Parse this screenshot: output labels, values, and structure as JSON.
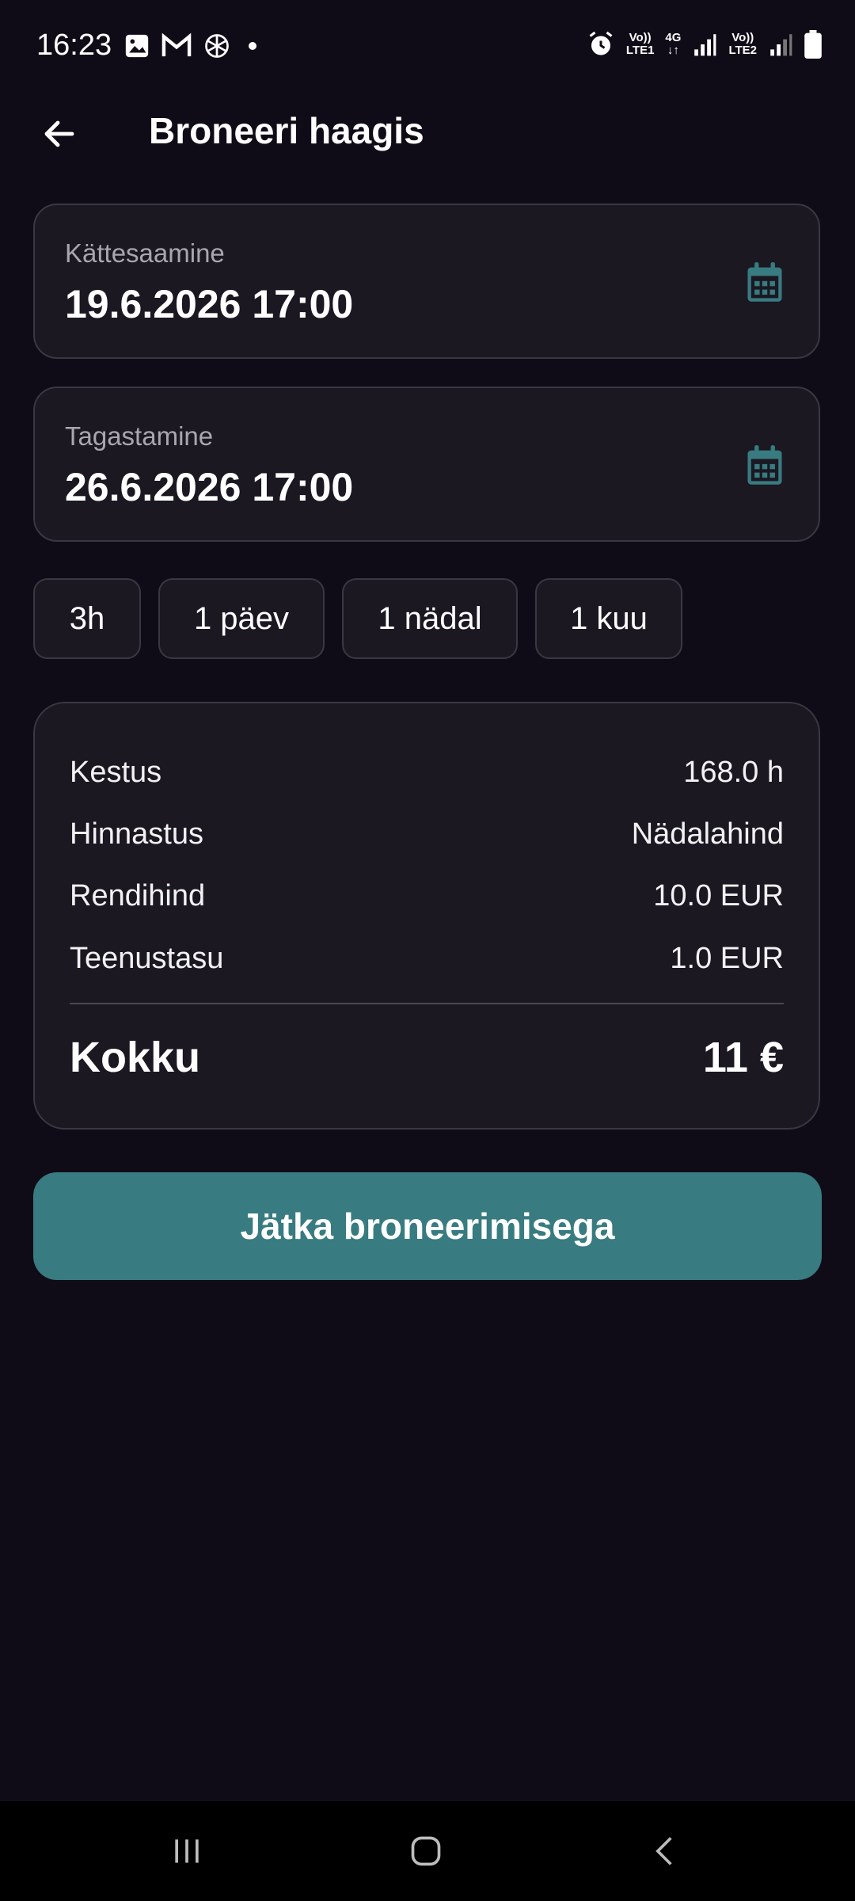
{
  "status_bar": {
    "time": "16:23",
    "left_icons": [
      "gallery-icon",
      "gmail-icon",
      "chatgpt-icon",
      "dot-icon"
    ],
    "net1_top": "Vo))",
    "net1_bottom": "LTE1",
    "net_mid_top": "4G",
    "net2_top": "Vo))",
    "net2_bottom": "LTE2",
    "right_icons": [
      "alarm-icon",
      "signal-icon",
      "battery-icon"
    ]
  },
  "header": {
    "title": "Broneeri haagis",
    "back_icon": "arrow-left-icon"
  },
  "pickup": {
    "label": "Kättesaamine",
    "value": "19.6.2026 17:00",
    "icon": "calendar-icon"
  },
  "return": {
    "label": "Tagastamine",
    "value": "26.6.2026 17:00",
    "icon": "calendar-icon"
  },
  "quick_durations": [
    "3h",
    "1 päev",
    "1 nädal",
    "1 kuu"
  ],
  "summary": {
    "rows": [
      {
        "label": "Kestus",
        "value": "168.0 h"
      },
      {
        "label": "Hinnastus",
        "value": "Nädalahind"
      },
      {
        "label": "Rendihind",
        "value": "10.0 EUR"
      },
      {
        "label": "Teenustasu",
        "value": "1.0 EUR"
      }
    ],
    "total_label": "Kokku",
    "total_value": "11 €"
  },
  "continue_button": "Jätka broneerimisega",
  "colors": {
    "background": "#100c17",
    "card": "#1b1822",
    "border": "#3a3745",
    "accent": "#387b80"
  },
  "navbar": {
    "icons": [
      "recent-apps-icon",
      "home-icon",
      "back-nav-icon"
    ]
  }
}
